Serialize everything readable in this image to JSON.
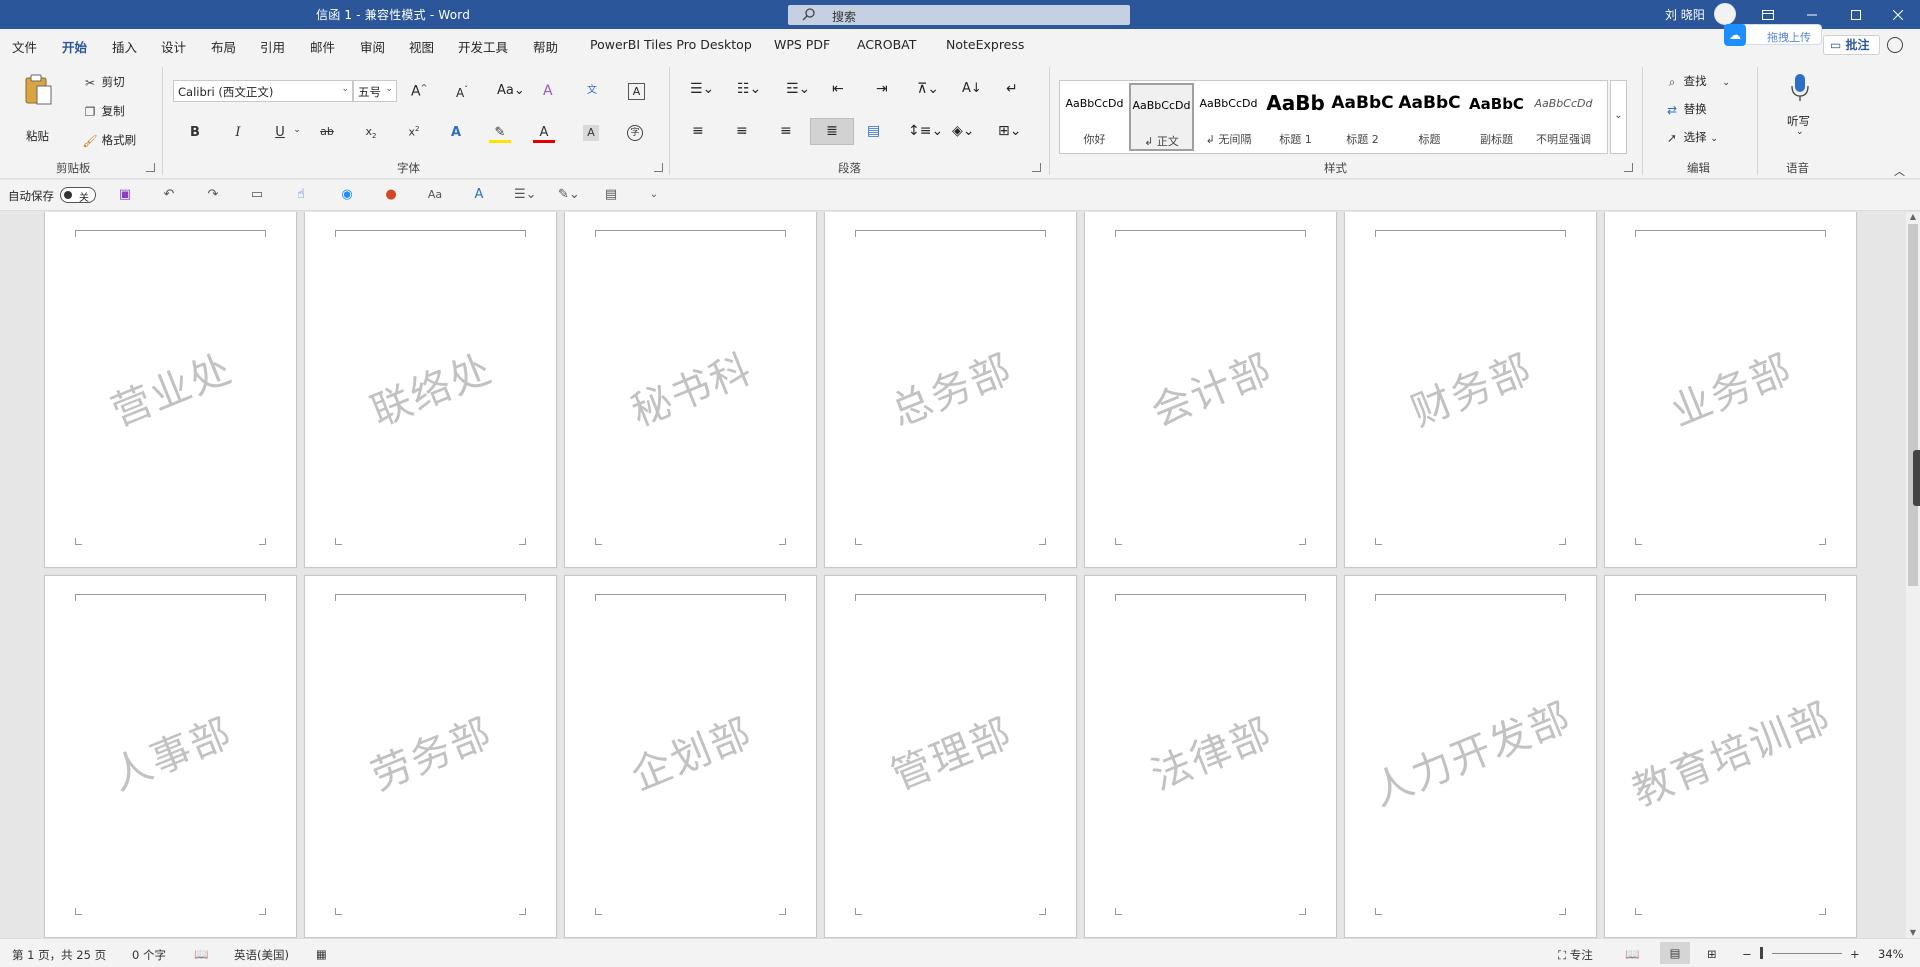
{
  "titlebar": {
    "doc_title": "信函 1  -  兼容性模式  -  Word",
    "search_placeholder": "搜索",
    "user_name": "刘 晓阳",
    "upload_label": "拖拽上传",
    "comment_label": "批注"
  },
  "tabs": [
    "文件",
    "开始",
    "插入",
    "设计",
    "布局",
    "引用",
    "邮件",
    "审阅",
    "视图",
    "开发工具",
    "帮助",
    "PowerBI Tiles Pro Desktop",
    "WPS PDF",
    "ACROBAT",
    "NoteExpress"
  ],
  "active_tab": "开始",
  "ribbon": {
    "clipboard": {
      "paste": "粘贴",
      "cut": "剪切",
      "copy": "复制",
      "format_painter": "格式刷",
      "group": "剪贴板"
    },
    "font": {
      "name": "Calibri (西文正文)",
      "size": "五号",
      "group": "字体"
    },
    "paragraph": {
      "group": "段落"
    },
    "styles": {
      "group": "样式",
      "items": [
        {
          "sample": "AaBbCcDd",
          "name": "你好"
        },
        {
          "sample": "AaBbCcDd",
          "name": "↲ 正文"
        },
        {
          "sample": "AaBbCcDd",
          "name": "↲ 无间隔"
        },
        {
          "sample": "AaBb",
          "name": "标题 1"
        },
        {
          "sample": "AaBbC",
          "name": "标题 2"
        },
        {
          "sample": "AaBbC",
          "name": "标题"
        },
        {
          "sample": "AaBbC",
          "name": "副标题"
        },
        {
          "sample": "AaBbCcDd",
          "name": "不明显强调"
        }
      ]
    },
    "editing": {
      "find": "查找",
      "replace": "替换",
      "select": "选择",
      "group": "编辑"
    },
    "voice": {
      "dictate": "听写",
      "group": "语音"
    }
  },
  "qat": {
    "autosave_label": "自动保存",
    "toggle_state": "关"
  },
  "pages": {
    "row1": [
      "营业处",
      "联络处",
      "秘书科",
      "总务部",
      "会计部",
      "财务部",
      "业务部"
    ],
    "row2": [
      "人事部",
      "劳务部",
      "企划部",
      "管理部",
      "法律部",
      "人力开发部",
      "教育培训部"
    ]
  },
  "status": {
    "page_info": "第 1 页，共 25 页",
    "word_count": "0 个字",
    "language": "英语(美国)",
    "focus": "专注",
    "zoom": "34%"
  }
}
